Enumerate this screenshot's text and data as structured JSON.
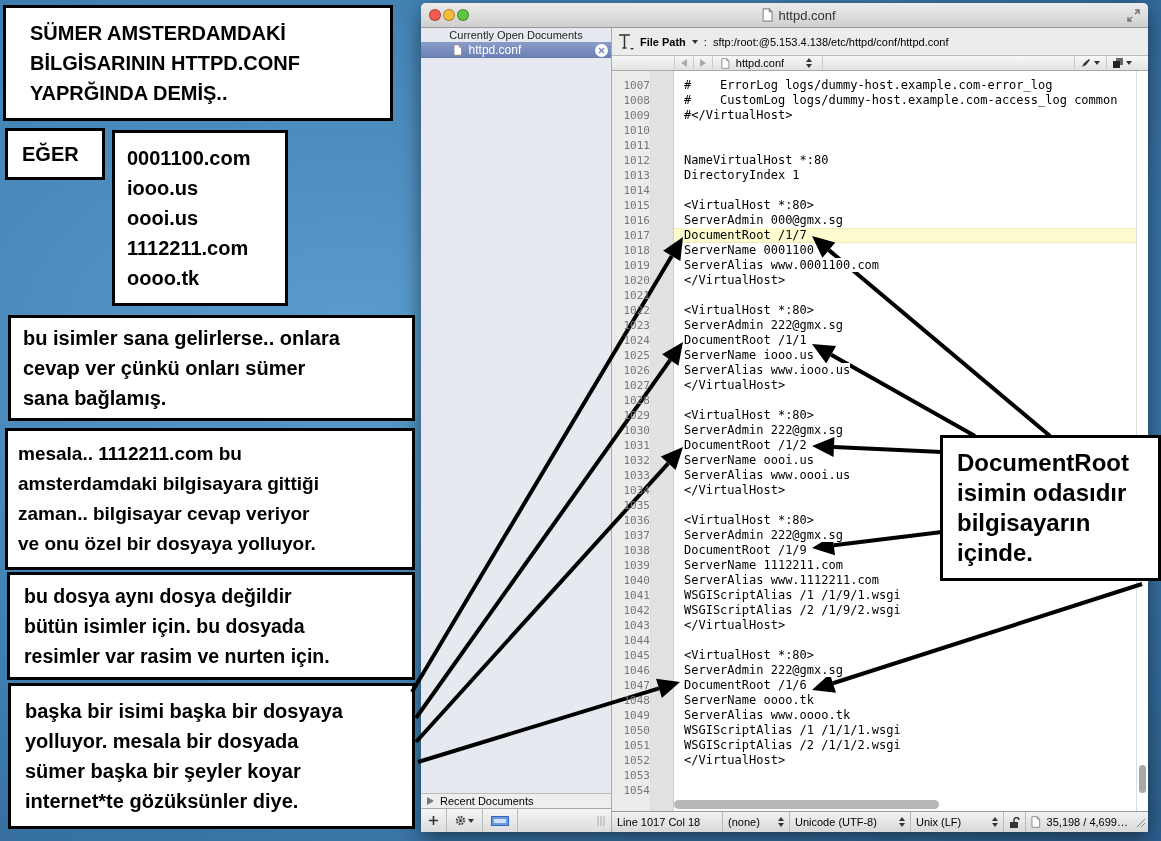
{
  "notes": [
    {
      "kind": "heading",
      "text": "SÜMER AMSTERDAMDAKİ\nBİLGİSARININ HTTPD.CONF\nYAPRĞINDA DEMİŞ.."
    },
    {
      "kind": "label",
      "text": "EĞER"
    },
    {
      "kind": "list",
      "items": [
        "0001100.com",
        "iooo.us",
        "oooi.us",
        "1112211.com",
        "oooo.tk"
      ]
    },
    {
      "kind": "text",
      "text": "bu isimler sana gelirlerse.. onlara\ncevap ver çünkü onları sümer\nsana bağlamış."
    },
    {
      "kind": "text",
      "text": "mesala.. 1112211.com bu\namsterdamdaki bilgisayara gittiği\nzaman.. bilgisayar cevap veriyor\nve onu özel bir dosyaya yolluyor."
    },
    {
      "kind": "text",
      "text": "bu dosya aynı dosya değildir\nbütün isimler için. bu dosyada\nresimler var rasim ve nurten için."
    },
    {
      "kind": "text",
      "text": "başka bir isimi başka bir dosyaya\nyolluyor. mesala bir dosyada\nsümer başka bir şeyler koyar\ninternet*te gözüksünler diye."
    },
    {
      "kind": "callout",
      "text": "DocumentRoot\nisimin odasıdır\nbilgisayarın\niçinde."
    }
  ],
  "window": {
    "title": "httpd.conf"
  },
  "sidebar": {
    "header": "Currently Open Documents",
    "documents": [
      {
        "name": "httpd.conf",
        "selected": true
      }
    ],
    "recent": "Recent Documents"
  },
  "toolbar": {
    "file_path_label": "File Path",
    "separator": ":",
    "file_path": "sftp:/root:@5.153.4.138/etc/httpd/conf/httpd.conf"
  },
  "navbar": {
    "document": "httpd.conf"
  },
  "code": [
    {
      "number": "1007",
      "text": "#    ErrorLog logs/dummy-host.example.com-error_log",
      "current": false
    },
    {
      "number": "1008",
      "text": "#    CustomLog logs/dummy-host.example.com-access_log common",
      "current": false
    },
    {
      "number": "1009",
      "text": "#</VirtualHost>",
      "current": false
    },
    {
      "number": "1010",
      "current": false
    },
    {
      "number": "1011",
      "current": false
    },
    {
      "number": "1012",
      "text": "NameVirtualHost *:80",
      "current": false
    },
    {
      "number": "1013",
      "text": "DirectoryIndex 1",
      "current": false
    },
    {
      "number": "1014",
      "current": false
    },
    {
      "number": "1015",
      "text": "<VirtualHost *:80>",
      "current": false
    },
    {
      "number": "1016",
      "text": "ServerAdmin 000@gmx.sg",
      "current": false
    },
    {
      "number": "1017",
      "text": "DocumentRoot /1/7",
      "current": true
    },
    {
      "number": "1018",
      "text": "ServerName 0001100",
      "current": false
    },
    {
      "number": "1019",
      "text": "ServerAlias www.0001100.com",
      "current": false
    },
    {
      "number": "1020",
      "text": "</VirtualHost>",
      "current": false
    },
    {
      "number": "1021",
      "current": false
    },
    {
      "number": "1022",
      "text": "<VirtualHost *:80>",
      "current": false
    },
    {
      "number": "1023",
      "text": "ServerAdmin 222@gmx.sg",
      "current": false
    },
    {
      "number": "1024",
      "text": "DocumentRoot /1/1",
      "current": false
    },
    {
      "number": "1025",
      "text": "ServerName iooo.us",
      "current": false
    },
    {
      "number": "1026",
      "text": "ServerAlias www.iooo.us",
      "current": false
    },
    {
      "number": "1027",
      "text": "</VirtualHost>",
      "current": false
    },
    {
      "number": "1028",
      "current": false
    },
    {
      "number": "1029",
      "text": "<VirtualHost *:80>",
      "current": false
    },
    {
      "number": "1030",
      "text": "ServerAdmin 222@gmx.sg",
      "current": false
    },
    {
      "number": "1031",
      "text": "DocumentRoot /1/2",
      "current": false
    },
    {
      "number": "1032",
      "text": "ServerName oooi.us",
      "current": false
    },
    {
      "number": "1033",
      "text": "ServerAlias www.oooi.us",
      "current": false
    },
    {
      "number": "1034",
      "text": "</VirtualHost>",
      "current": false
    },
    {
      "number": "1035",
      "current": false
    },
    {
      "number": "1036",
      "text": "<VirtualHost *:80>",
      "current": false
    },
    {
      "number": "1037",
      "text": "ServerAdmin 222@gmx.sg",
      "current": false
    },
    {
      "number": "1038",
      "text": "DocumentRoot /1/9",
      "current": false
    },
    {
      "number": "1039",
      "text": "ServerName 1112211.com",
      "current": false
    },
    {
      "number": "1040",
      "text": "ServerAlias www.1112211.com",
      "current": false
    },
    {
      "number": "1041",
      "text": "WSGIScriptAlias /1 /1/9/1.wsgi",
      "current": false
    },
    {
      "number": "1042",
      "text": "WSGIScriptAlias /2 /1/9/2.wsgi",
      "current": false
    },
    {
      "number": "1043",
      "text": "</VirtualHost>",
      "current": false
    },
    {
      "number": "1044",
      "current": false
    },
    {
      "number": "1045",
      "text": "<VirtualHost *:80>",
      "current": false
    },
    {
      "number": "1046",
      "text": "ServerAdmin 222@gmx.sg",
      "current": false
    },
    {
      "number": "1047",
      "text": "DocumentRoot /1/6",
      "current": false
    },
    {
      "number": "1048",
      "text": "ServerName oooo.tk",
      "current": false
    },
    {
      "number": "1049",
      "text": "ServerAlias www.oooo.tk",
      "current": false
    },
    {
      "number": "1050",
      "text": "WSGIScriptAlias /1 /1/1/1.wsgi",
      "current": false
    },
    {
      "number": "1051",
      "text": "WSGIScriptAlias /2 /1/1/2.wsgi",
      "current": false
    },
    {
      "number": "1052",
      "text": "</VirtualHost>",
      "current": false
    },
    {
      "number": "1053",
      "current": false
    },
    {
      "number": "1054",
      "current": false
    }
  ],
  "status_bar": {
    "position": "Line 1017 Col 18",
    "syntax": "(none)",
    "encoding": "Unicode (UTF-8)",
    "line_endings": "Unix (LF)",
    "size": "35,198 / 4,699…"
  }
}
